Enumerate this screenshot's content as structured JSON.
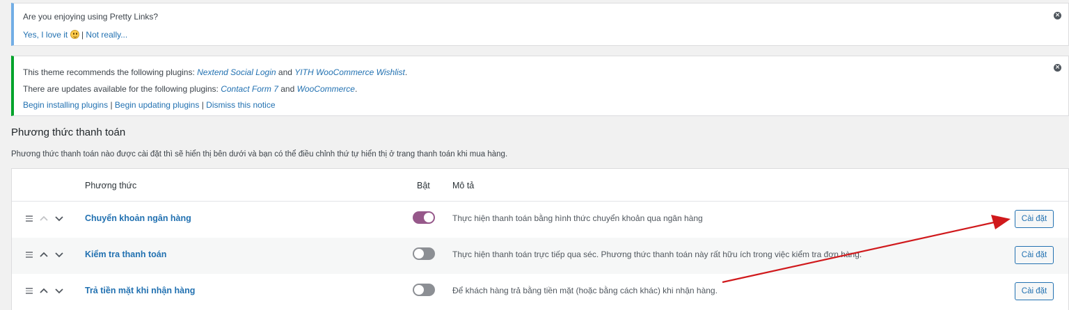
{
  "notice_rating": {
    "question": "Are you enjoying using Pretty Links?",
    "yes_link": "Yes, I love it",
    "separator": "|",
    "no_link": "Not really..."
  },
  "notice_plugins": {
    "line1_prefix": "This theme recommends the following plugins:",
    "line1_plugin1": "Nextend Social Login",
    "line1_and": "and",
    "line1_plugin2": "YITH WooCommerce Wishlist",
    "line1_end": ".",
    "line2_prefix": "There are updates available for the following plugins:",
    "line2_plugin1": "Contact Form 7",
    "line2_and": "and",
    "line2_plugin2": "WooCommerce",
    "line2_end": ".",
    "action_install": "Begin installing plugins",
    "action_update": "Begin updating plugins",
    "action_dismiss": "Dismiss this notice",
    "sep": "|"
  },
  "section": {
    "title": "Phương thức thanh toán",
    "description": "Phương thức thanh toán nào được cài đặt thì sẽ hiển thị bên dưới và bạn có thể điều chỉnh thứ tự hiển thị ở trang thanh toán khi mua hàng."
  },
  "table": {
    "headers": {
      "method": "Phương thức",
      "enabled": "Bật",
      "description": "Mô tả"
    },
    "rows": [
      {
        "name": "Chuyển khoản ngân hàng",
        "enabled": true,
        "description": "Thực hiện thanh toán bằng hình thức chuyển khoản qua ngân hàng",
        "button": "Cài đặt"
      },
      {
        "name": "Kiểm tra thanh toán",
        "enabled": false,
        "description": "Thực hiện thanh toán trực tiếp qua séc. Phương thức thanh toán này rất hữu ích trong việc kiểm tra đơn hàng.",
        "button": "Cài đặt"
      },
      {
        "name": "Trả tiền mặt khi nhận hàng",
        "enabled": false,
        "description": "Để khách hàng trả bằng tiền mặt (hoặc bằng cách khác) khi nhận hàng.",
        "button": "Cài đặt"
      }
    ]
  },
  "icons": {
    "dismiss": "close-circle-icon",
    "smiley": "smiley-face-icon",
    "handle": "drag-handle-icon",
    "up": "chevron-up-icon",
    "down": "chevron-down-icon"
  },
  "colors": {
    "accent_link": "#2271b1",
    "toggle_on": "#96588a",
    "toggle_off": "#8c8f94",
    "notice_info_border": "#72aee6",
    "notice_success_border": "#00a32a",
    "annotation_arrow": "#d0191c"
  }
}
